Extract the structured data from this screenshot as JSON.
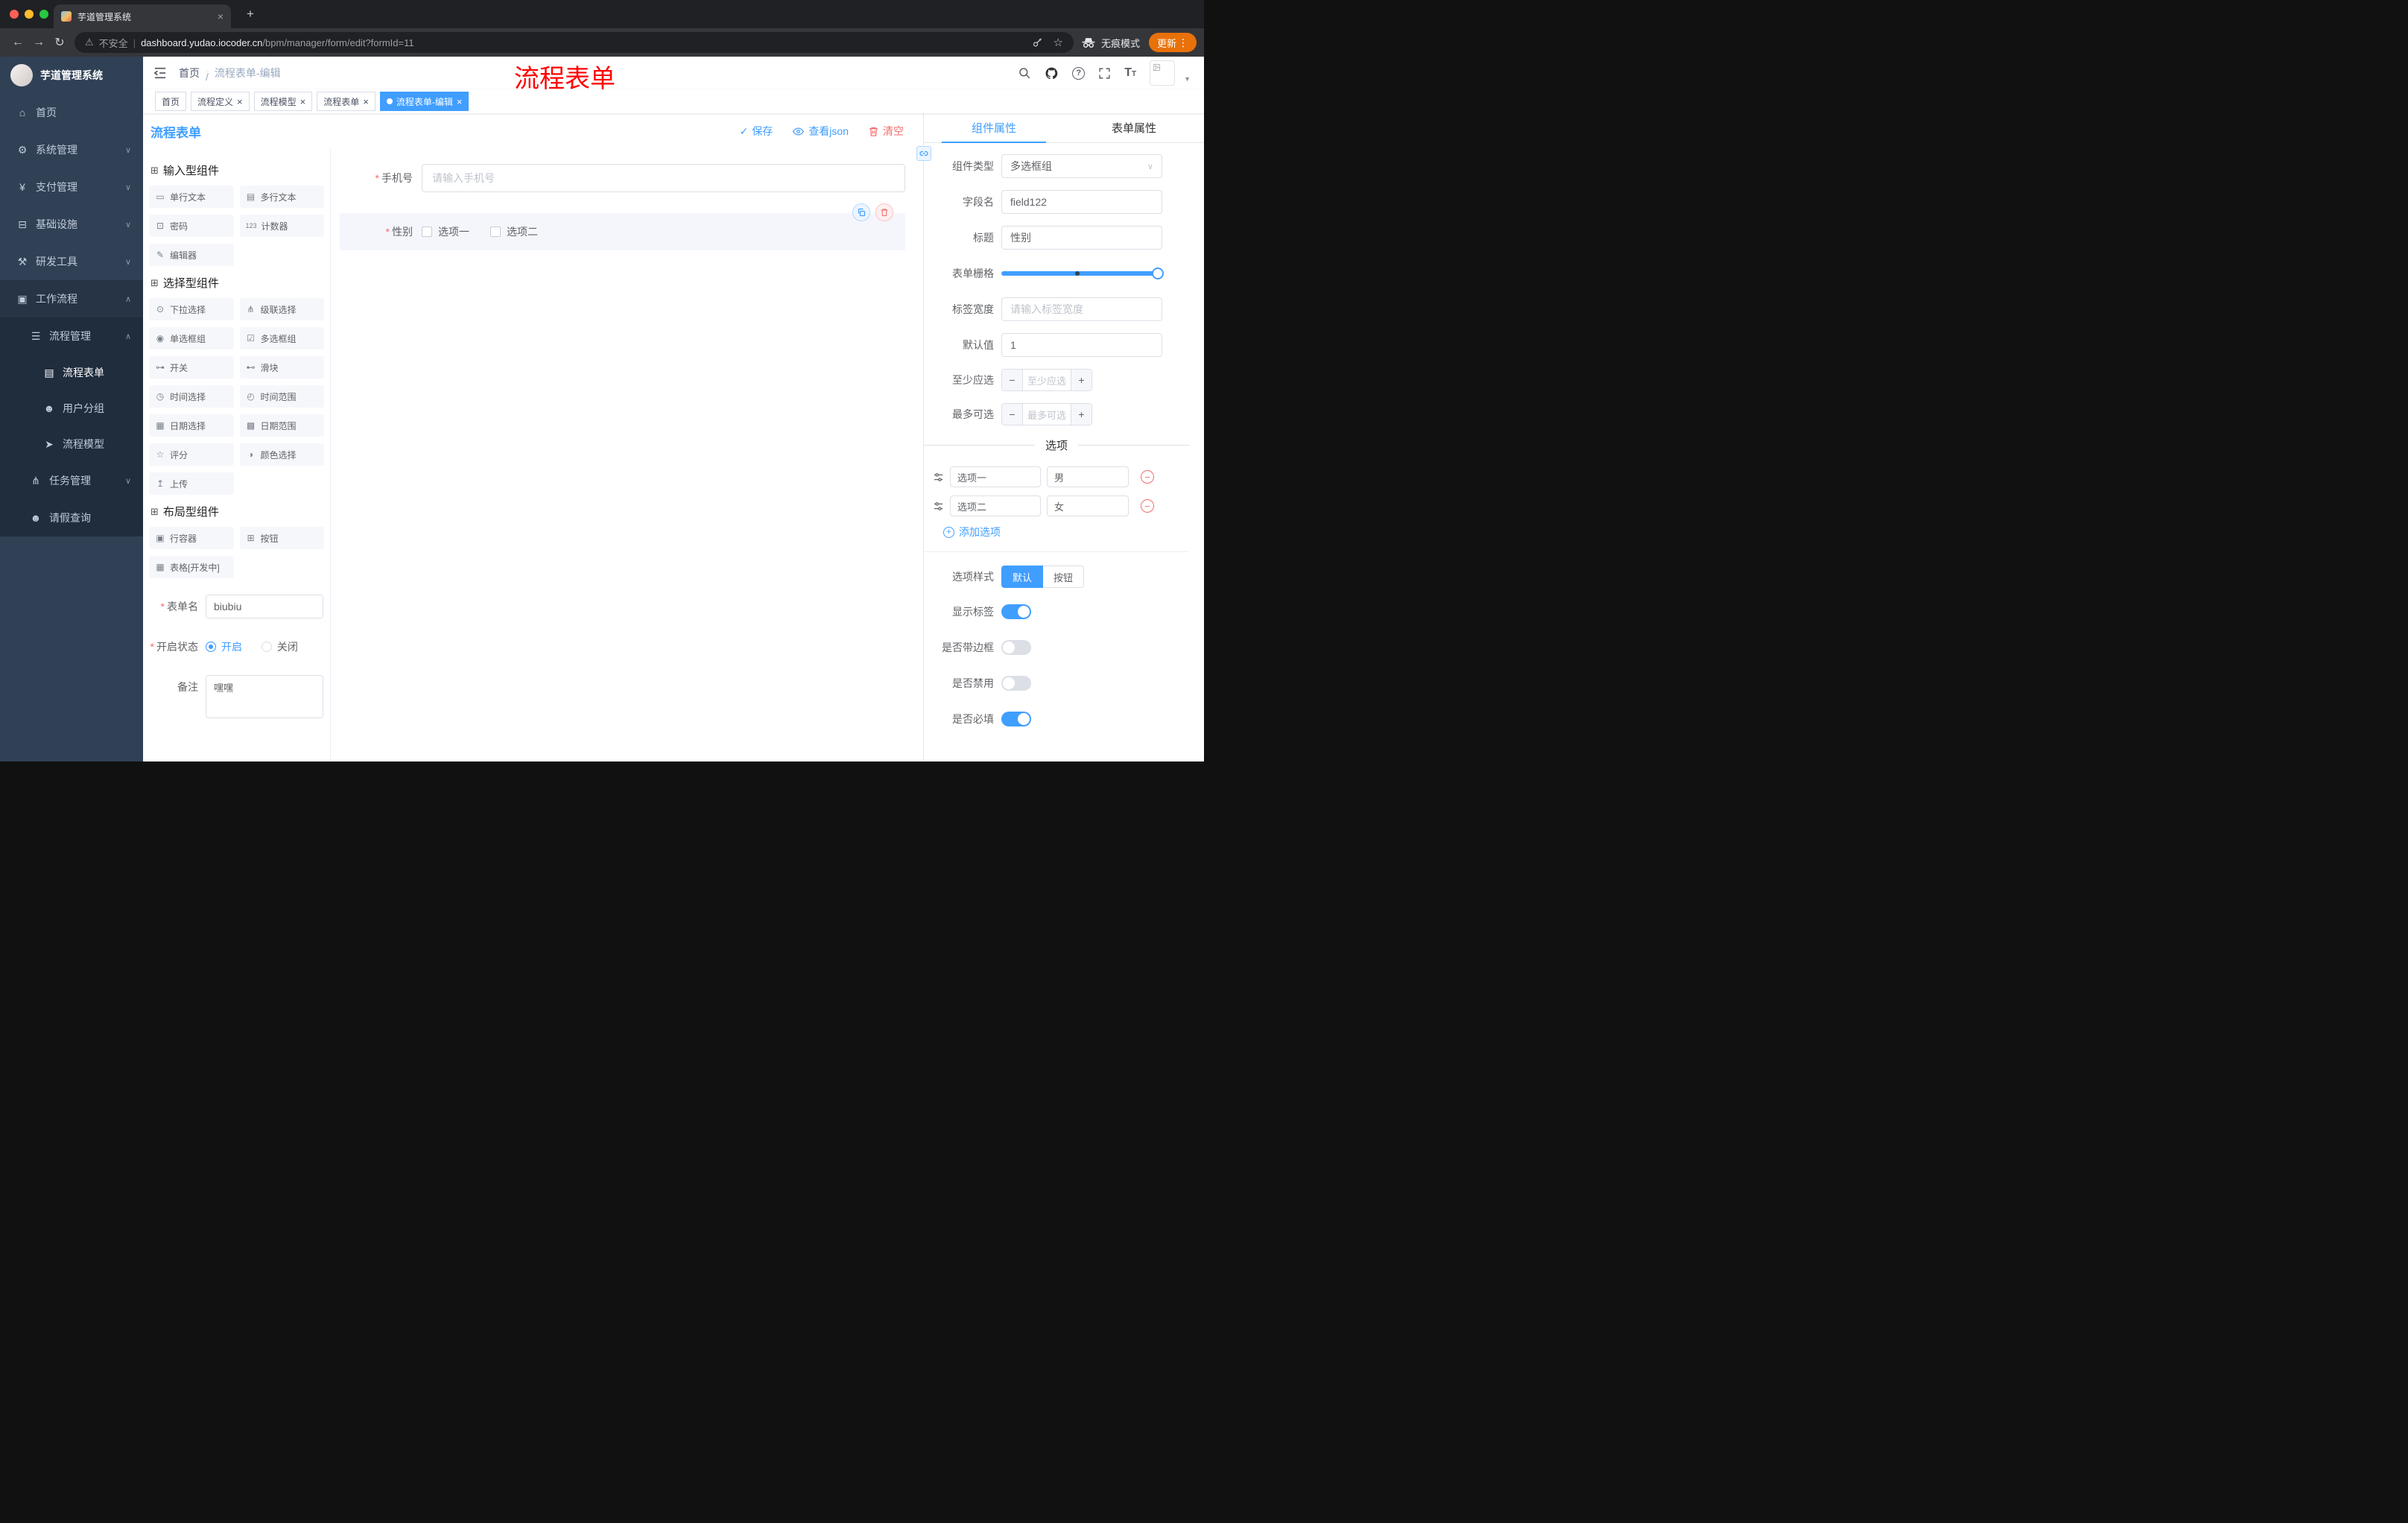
{
  "browser": {
    "tab": {
      "title": "芋道管理系统"
    },
    "address": {
      "security": "不安全",
      "host": "dashboard.yudao.iocoder.cn",
      "path": "/bpm/manager/form/edit?formId=11"
    },
    "incognito": "无痕模式",
    "update": "更新"
  },
  "sidebar": {
    "title": "芋道管理系统",
    "items": [
      {
        "glyph": "⌂",
        "label": "首页",
        "chevron": ""
      },
      {
        "glyph": "⚙",
        "label": "系统管理",
        "chevron": "∨"
      },
      {
        "glyph": "¥",
        "label": "支付管理",
        "chevron": "∨"
      },
      {
        "glyph": "⊟",
        "label": "基础设施",
        "chevron": "∨"
      },
      {
        "glyph": "⚒",
        "label": "研发工具",
        "chevron": "∨"
      },
      {
        "glyph": "▣",
        "label": "工作流程",
        "chevron": "∧"
      },
      {
        "glyph": "☰",
        "label": "流程管理",
        "chevron": "∧"
      },
      {
        "glyph": "▤",
        "label": "流程表单",
        "chevron": ""
      },
      {
        "glyph": "☻",
        "label": "用户分组",
        "chevron": ""
      },
      {
        "glyph": "➤",
        "label": "流程模型",
        "chevron": ""
      },
      {
        "glyph": "⋔",
        "label": "任务管理",
        "chevron": "∨"
      },
      {
        "glyph": "☻",
        "label": "请假查询",
        "chevron": ""
      }
    ]
  },
  "header": {
    "breadcrumb": {
      "home": "首页",
      "sep": "/",
      "current": "流程表单-编辑"
    },
    "annotation": "流程表单"
  },
  "tags": [
    {
      "label": "首页"
    },
    {
      "label": "流程定义"
    },
    {
      "label": "流程模型"
    },
    {
      "label": "流程表单"
    },
    {
      "label": "流程表单-编辑"
    }
  ],
  "designer": {
    "title": "流程表单",
    "actions": {
      "save": "保存",
      "view_json": "查看json",
      "clear": "清空"
    },
    "input_components": {
      "glyph": "⊞",
      "title": "输入型组件",
      "items": [
        {
          "glyph": "▭",
          "label": "单行文本"
        },
        {
          "glyph": "▤",
          "label": "多行文本"
        },
        {
          "glyph": "⊡",
          "label": "密码"
        },
        {
          "glyph": "123",
          "label": "计数器"
        },
        {
          "glyph": "✎",
          "label": "编辑器"
        }
      ]
    },
    "select_components": {
      "glyph": "⊞",
      "title": "选择型组件",
      "items": [
        {
          "glyph": "⊙",
          "label": "下拉选择"
        },
        {
          "glyph": "⋔",
          "label": "级联选择"
        },
        {
          "glyph": "◉",
          "label": "单选框组"
        },
        {
          "glyph": "☑",
          "label": "多选框组"
        },
        {
          "glyph": "⊶",
          "label": "开关"
        },
        {
          "glyph": "⊷",
          "label": "滑块"
        },
        {
          "glyph": "◷",
          "label": "时间选择"
        },
        {
          "glyph": "◴",
          "label": "时间范围"
        },
        {
          "glyph": "▦",
          "label": "日期选择"
        },
        {
          "glyph": "▩",
          "label": "日期范围"
        },
        {
          "glyph": "☆",
          "label": "评分"
        },
        {
          "glyph": "◑",
          "label": "颜色选择"
        },
        {
          "glyph": "↥",
          "label": "上传"
        }
      ]
    },
    "layout_components": {
      "glyph": "⊞",
      "title": "布局型组件",
      "items": [
        {
          "glyph": "▣",
          "label": "行容器"
        },
        {
          "glyph": "⊞",
          "label": "按钮"
        },
        {
          "glyph": "▦",
          "label": "表格[开发中]"
        }
      ]
    },
    "meta": {
      "form_name_label": "表单名",
      "form_name_value": "biubiu",
      "status_label": "开启状态",
      "status_on": "开启",
      "status_off": "关闭",
      "remark_label": "备注",
      "remark_value": "嘿嘿"
    },
    "canvas": {
      "phone": {
        "label": "手机号",
        "placeholder": "请输入手机号"
      },
      "gender": {
        "label": "性别",
        "options": [
          "选项一",
          "选项二"
        ]
      }
    }
  },
  "properties": {
    "tab_component": "组件属性",
    "tab_form": "表单属性",
    "component_type": {
      "label": "组件类型",
      "value": "多选框组"
    },
    "field_name": {
      "label": "字段名",
      "value": "field122"
    },
    "title_row": {
      "label": "标题",
      "value": "性别"
    },
    "grid": {
      "label": "表单栅格"
    },
    "label_width": {
      "label": "标签宽度",
      "placeholder": "请输入标签宽度"
    },
    "default_value": {
      "label": "默认值",
      "value": "1"
    },
    "min_select": {
      "label": "至少应选",
      "placeholder": "至少应选"
    },
    "max_select": {
      "label": "最多可选",
      "placeholder": "最多可选"
    },
    "options": {
      "title": "选项",
      "rows": [
        {
          "label": "选项一",
          "value": "男"
        },
        {
          "label": "选项二",
          "value": "女"
        }
      ],
      "add": "添加选项"
    },
    "option_style": {
      "label": "选项样式",
      "on": "默认",
      "off": "按钮"
    },
    "switches": [
      {
        "label": "显示标签",
        "on": true
      },
      {
        "label": "是否带边框",
        "on": false
      },
      {
        "label": "是否禁用",
        "on": false
      },
      {
        "label": "是否必填",
        "on": true
      }
    ]
  },
  "colors": {
    "accent": "#409eff",
    "danger": "#f56c6c",
    "annotation": "#fe0202"
  }
}
